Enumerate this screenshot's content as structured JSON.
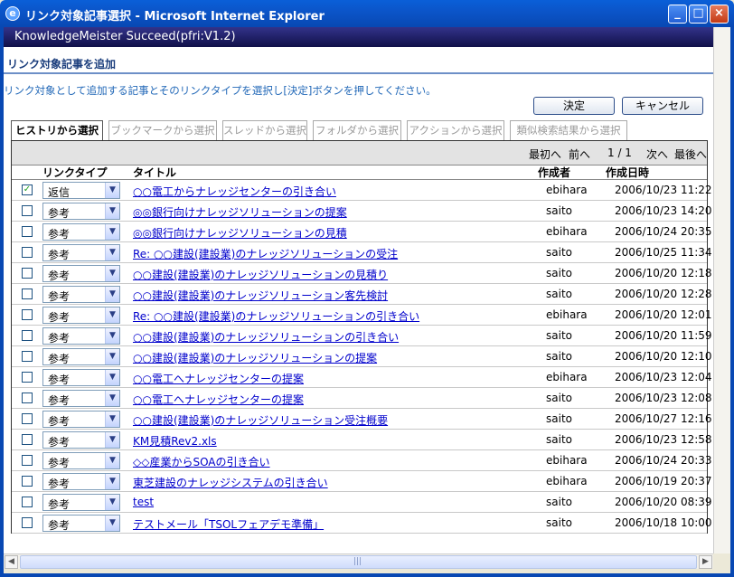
{
  "window": {
    "title": "リンク対象記事選択 - Microsoft Internet Explorer",
    "min_glyph": "_",
    "max_glyph": "□",
    "close_glyph": "×"
  },
  "app": {
    "banner": "KnowledgeMeister Succeed(pfri:V1.2)"
  },
  "section": {
    "title": "リンク対象記事を追加",
    "instruction": "リンク対象として追加する記事とそのリンクタイプを選択し[決定]ボタンを押してください。"
  },
  "buttons": {
    "ok": "決定",
    "cancel": "キャンセル"
  },
  "tabs": [
    {
      "label": "ヒストリから選択"
    },
    {
      "label": "ブックマークから選択"
    },
    {
      "label": "スレッドから選択"
    },
    {
      "label": "フォルダから選択"
    },
    {
      "label": "アクションから選択"
    },
    {
      "label": "類似検索結果から選択"
    }
  ],
  "pager": {
    "first": "最初へ",
    "prev": "前へ",
    "page": "1 / 1",
    "next": "次へ",
    "last": "最後へ"
  },
  "table": {
    "headers": {
      "link_type": "リンクタイプ",
      "title": "タイトル",
      "author": "作成者",
      "date": "作成日時"
    },
    "rows": [
      {
        "checked": "✓",
        "type": "返信",
        "title": "○○電工からナレッジセンターの引き合い",
        "author": "ebihara",
        "date": "2006/10/23 11:22"
      },
      {
        "checked": "",
        "type": "参考",
        "title": "◎◎銀行向けナレッジソリューションの提案",
        "author": "saito",
        "date": "2006/10/23 14:20"
      },
      {
        "checked": "",
        "type": "参考",
        "title": "◎◎銀行向けナレッジソリューションの見積",
        "author": "ebihara",
        "date": "2006/10/24 20:35"
      },
      {
        "checked": "",
        "type": "参考",
        "title": "Re: ○○建設(建設業)のナレッジソリューションの受注",
        "author": "saito",
        "date": "2006/10/25 11:34"
      },
      {
        "checked": "",
        "type": "参考",
        "title": "○○建設(建設業)のナレッジソリューションの見積り",
        "author": "saito",
        "date": "2006/10/20 12:18"
      },
      {
        "checked": "",
        "type": "参考",
        "title": "○○建設(建設業)のナレッジソリューション客先検討",
        "author": "saito",
        "date": "2006/10/20 12:28"
      },
      {
        "checked": "",
        "type": "参考",
        "title": "Re: ○○建設(建設業)のナレッジソリューションの引き合い",
        "author": "ebihara",
        "date": "2006/10/20 12:01"
      },
      {
        "checked": "",
        "type": "参考",
        "title": "○○建設(建設業)のナレッジソリューションの引き合い",
        "author": "saito",
        "date": "2006/10/20 11:59"
      },
      {
        "checked": "",
        "type": "参考",
        "title": "○○建設(建設業)のナレッジソリューションの提案",
        "author": "saito",
        "date": "2006/10/20 12:10"
      },
      {
        "checked": "",
        "type": "参考",
        "title": "○○電工へナレッジセンターの提案",
        "author": "ebihara",
        "date": "2006/10/23 12:04"
      },
      {
        "checked": "",
        "type": "参考",
        "title": "○○電工へナレッジセンターの提案",
        "author": "saito",
        "date": "2006/10/23 12:08"
      },
      {
        "checked": "",
        "type": "参考",
        "title": "○○建設(建設業)のナレッジソリューション受注概要",
        "author": "saito",
        "date": "2006/10/27 12:16"
      },
      {
        "checked": "",
        "type": "参考",
        "title": "KM見積Rev2.xls",
        "author": "saito",
        "date": "2006/10/23 12:58"
      },
      {
        "checked": "",
        "type": "参考",
        "title": "◇◇産業からSOAの引き合い",
        "author": "ebihara",
        "date": "2006/10/24 20:33"
      },
      {
        "checked": "",
        "type": "参考",
        "title": "東芝建設のナレッジシステムの引き合い",
        "author": "ebihara",
        "date": "2006/10/19 20:37"
      },
      {
        "checked": "",
        "type": "参考",
        "title": "test",
        "author": "saito",
        "date": "2006/10/20 08:39"
      },
      {
        "checked": "",
        "type": "参考",
        "title": "テストメール「TSOLフェアデモ準備」",
        "author": "saito",
        "date": "2006/10/18 10:00"
      }
    ]
  },
  "scrollbar": {
    "thumb_grip": "|||"
  }
}
